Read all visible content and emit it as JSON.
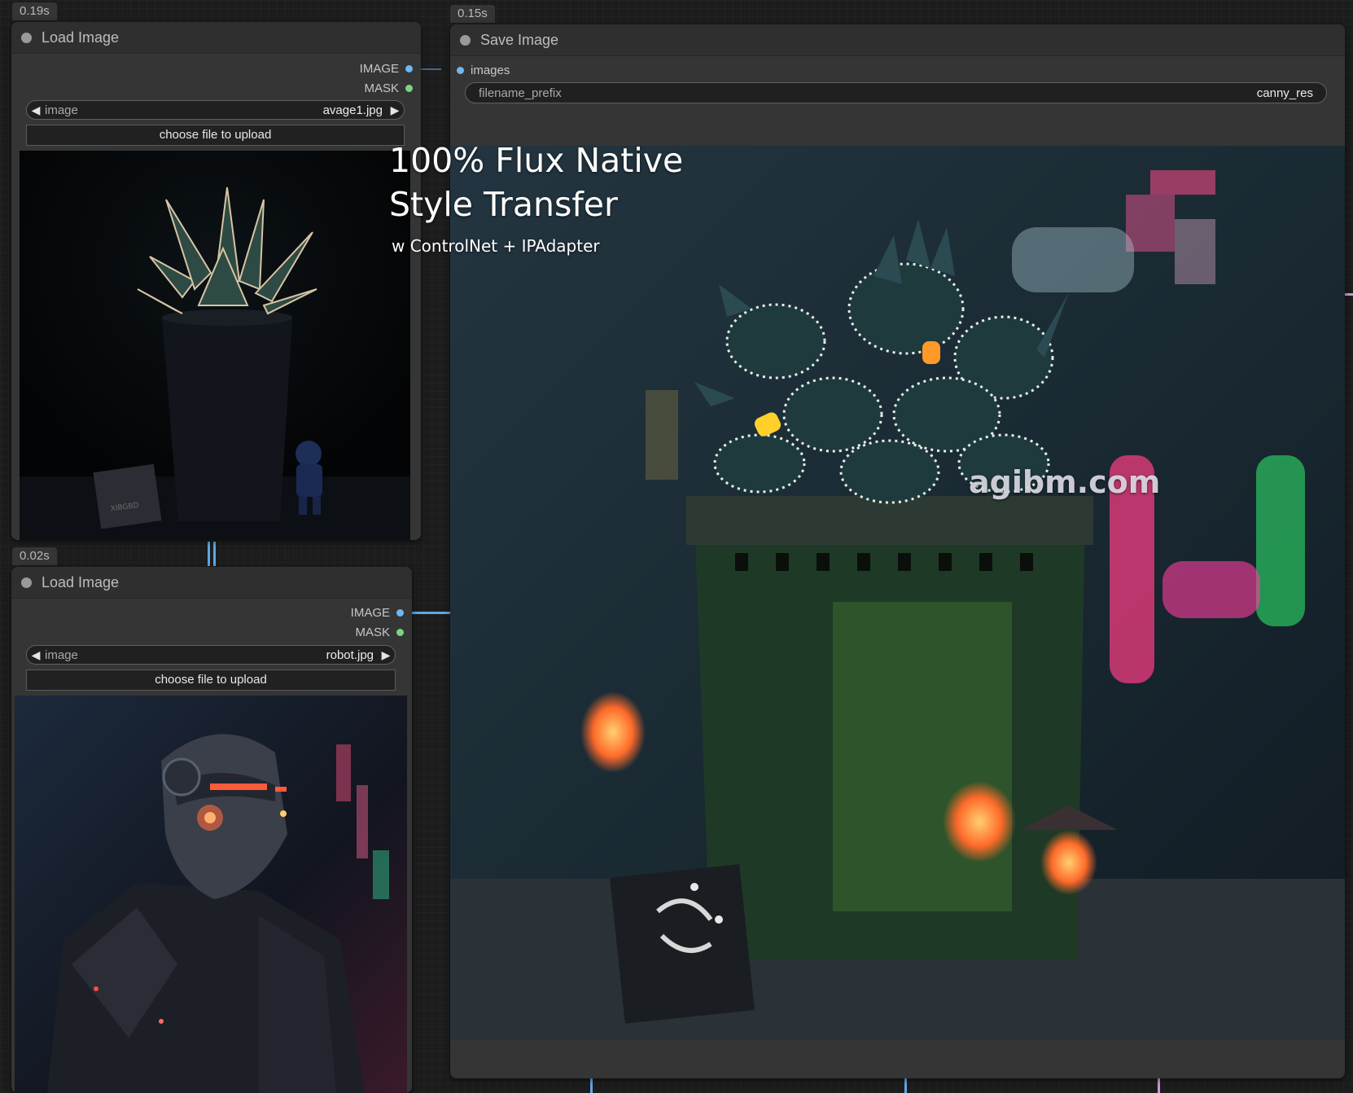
{
  "nodes": {
    "load_image_1": {
      "timing": "0.19s",
      "title": "Load Image",
      "outputs": [
        "IMAGE",
        "MASK"
      ],
      "image_widget": {
        "label": "image",
        "value": "avage1.jpg"
      },
      "upload_label": "choose file to upload",
      "preview_watermark": "XIBGBD"
    },
    "load_image_2": {
      "timing": "0.02s",
      "title": "Load Image",
      "outputs": [
        "IMAGE",
        "MASK"
      ],
      "image_widget": {
        "label": "image",
        "value": "robot.jpg"
      },
      "upload_label": "choose file to upload"
    },
    "save_image": {
      "timing": "0.15s",
      "title": "Save Image",
      "input": "images",
      "filename_prefix": {
        "label": "filename_prefix",
        "value": "canny_res"
      }
    }
  },
  "overlay": {
    "headline_line1": "100% Flux Native",
    "headline_line2": "Style Transfer",
    "subline": "w ControlNet + IPAdapter",
    "watermark": "agibm.com"
  },
  "colors": {
    "canvas": "#1c1c1c",
    "node_body": "#353535",
    "node_title": "#2f2f2f",
    "image_slot": "#6fb7ef",
    "mask_slot": "#7cd47f",
    "wire": "#5fa7e6"
  }
}
